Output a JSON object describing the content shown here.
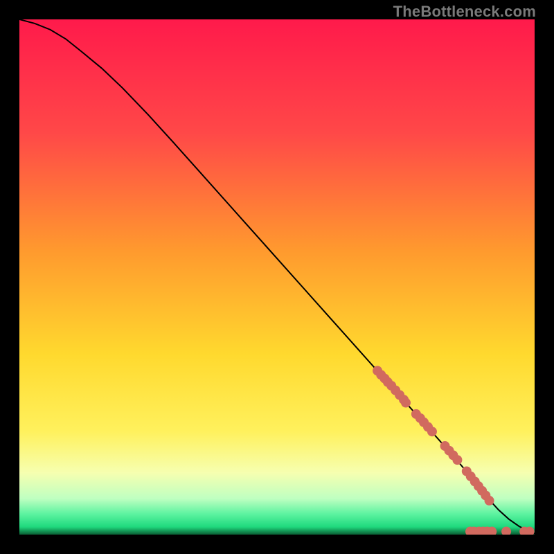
{
  "watermark": "TheBottleneck.com",
  "chart_data": {
    "type": "line",
    "title": "",
    "xlabel": "",
    "ylabel": "",
    "xlim": [
      0,
      100
    ],
    "ylim": [
      0,
      100
    ],
    "grid": false,
    "legend": false,
    "gradient_stops": [
      {
        "offset": 0,
        "color": "#ff1a4b"
      },
      {
        "offset": 22,
        "color": "#ff4848"
      },
      {
        "offset": 45,
        "color": "#ff9a2e"
      },
      {
        "offset": 65,
        "color": "#ffd92e"
      },
      {
        "offset": 80,
        "color": "#fff15d"
      },
      {
        "offset": 88,
        "color": "#f6ffb0"
      },
      {
        "offset": 93,
        "color": "#bfffc1"
      },
      {
        "offset": 96,
        "color": "#5cf3a0"
      },
      {
        "offset": 98.5,
        "color": "#1fd97e"
      },
      {
        "offset": 100,
        "color": "#0a5d33"
      }
    ],
    "series": [
      {
        "name": "curve",
        "type": "line",
        "color": "#000000",
        "x": [
          0,
          3,
          6,
          9,
          12,
          16,
          20,
          25,
          30,
          35,
          40,
          45,
          50,
          55,
          60,
          65,
          70,
          75,
          80,
          84,
          87,
          89,
          91,
          93,
          95,
          97,
          99,
          100
        ],
        "y": [
          100,
          99.2,
          98.0,
          96.2,
          93.8,
          90.5,
          86.7,
          81.5,
          76.0,
          70.4,
          64.8,
          59.2,
          53.6,
          48.0,
          42.4,
          36.8,
          31.2,
          25.6,
          20.0,
          15.5,
          12.0,
          9.5,
          7.0,
          4.8,
          3.0,
          1.6,
          0.6,
          0.2
        ]
      },
      {
        "name": "scatter",
        "type": "scatter",
        "color": "#d16a5f",
        "radius": 7,
        "points": [
          {
            "x": 69.5,
            "y": 31.8
          },
          {
            "x": 70.2,
            "y": 31.0
          },
          {
            "x": 70.9,
            "y": 30.3
          },
          {
            "x": 71.5,
            "y": 29.6
          },
          {
            "x": 72.2,
            "y": 28.9
          },
          {
            "x": 73.0,
            "y": 28.0
          },
          {
            "x": 73.8,
            "y": 27.1
          },
          {
            "x": 74.6,
            "y": 26.2
          },
          {
            "x": 75.0,
            "y": 25.6
          },
          {
            "x": 77.0,
            "y": 23.4
          },
          {
            "x": 77.8,
            "y": 22.6
          },
          {
            "x": 78.5,
            "y": 21.8
          },
          {
            "x": 79.3,
            "y": 20.9
          },
          {
            "x": 80.1,
            "y": 20.0
          },
          {
            "x": 82.6,
            "y": 17.2
          },
          {
            "x": 83.4,
            "y": 16.3
          },
          {
            "x": 84.2,
            "y": 15.4
          },
          {
            "x": 85.0,
            "y": 14.5
          },
          {
            "x": 86.8,
            "y": 12.3
          },
          {
            "x": 87.6,
            "y": 11.3
          },
          {
            "x": 88.4,
            "y": 10.3
          },
          {
            "x": 89.1,
            "y": 9.4
          },
          {
            "x": 89.8,
            "y": 8.5
          },
          {
            "x": 90.5,
            "y": 7.6
          },
          {
            "x": 91.2,
            "y": 6.6
          },
          {
            "x": 87.5,
            "y": 0.6
          },
          {
            "x": 88.2,
            "y": 0.6
          },
          {
            "x": 89.2,
            "y": 0.6
          },
          {
            "x": 90.0,
            "y": 0.6
          },
          {
            "x": 90.8,
            "y": 0.6
          },
          {
            "x": 91.7,
            "y": 0.6
          },
          {
            "x": 94.5,
            "y": 0.6
          },
          {
            "x": 98.0,
            "y": 0.6
          },
          {
            "x": 99.0,
            "y": 0.6
          }
        ]
      }
    ]
  }
}
